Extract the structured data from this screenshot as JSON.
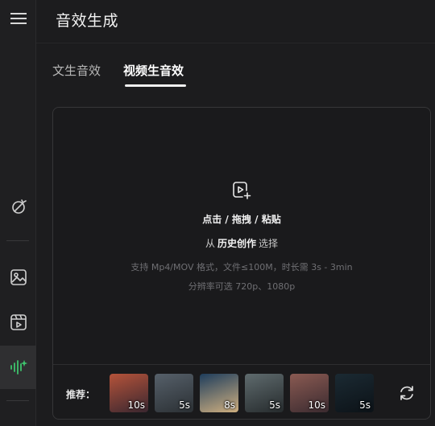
{
  "header": {
    "title": "音效生成"
  },
  "tabs": [
    {
      "label": "文生音效",
      "active": false
    },
    {
      "label": "视频生音效",
      "active": true
    }
  ],
  "upload": {
    "main_text": "点击 / 拖拽 / 粘贴",
    "history_prefix": "从",
    "history_link": "历史创作",
    "history_suffix": "选择",
    "hint_formats": "支持 Mp4/MOV 格式，文件≤100M，时长需 3s - 3min",
    "hint_resolution": "分辨率可选 720p、1080p"
  },
  "recommend": {
    "label": "推荐：",
    "items": [
      {
        "duration": "10s",
        "colors": [
          "#b5533a",
          "#3a2730"
        ]
      },
      {
        "duration": "5s",
        "colors": [
          "#56606a",
          "#2b3034"
        ]
      },
      {
        "duration": "8s",
        "colors": [
          "#1e3d5c",
          "#d0b080"
        ]
      },
      {
        "duration": "5s",
        "colors": [
          "#5f6b6e",
          "#262b2d"
        ]
      },
      {
        "duration": "10s",
        "colors": [
          "#8a5a52",
          "#3b2b30"
        ]
      },
      {
        "duration": "5s",
        "colors": [
          "#1b2a33",
          "#0c1217"
        ]
      }
    ]
  },
  "colors": {
    "background": "#1c1c1e",
    "sidebar": "#1f1f21",
    "accent_green": "#3ec46d",
    "text_primary": "#f0f0f0",
    "text_muted": "#6f6f73"
  },
  "icons": {
    "menu": "hamburger-menu-icon",
    "sidebar": [
      "magic-edit-icon",
      "image-icon",
      "video-icon",
      "audio-wave-icon"
    ],
    "upload": "video-add-icon",
    "refresh": "refresh-icon"
  }
}
